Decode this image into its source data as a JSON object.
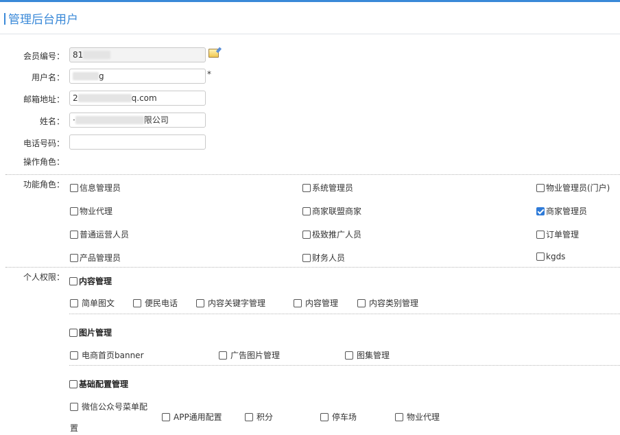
{
  "page": {
    "title": "管理后台用户",
    "accent": "#3a89d8"
  },
  "form": {
    "member_no": {
      "label": "会员编号：",
      "value": "81"
    },
    "username": {
      "label": "用户名：",
      "value_suffix": "g",
      "required_mark": "*"
    },
    "email": {
      "label": "邮箱地址：",
      "value_prefix": "2",
      "value_suffix": "q.com"
    },
    "name": {
      "label": "姓名：",
      "value_prefix": "·",
      "value_suffix": "限公司"
    },
    "phone": {
      "label": "电话号码：",
      "value": ""
    },
    "op_role": {
      "label": "操作角色："
    }
  },
  "function_roles": {
    "label": "功能角色：",
    "items": [
      {
        "label": "信息管理员",
        "checked": false
      },
      {
        "label": "系统管理员",
        "checked": false
      },
      {
        "label": "物业管理员(门户)",
        "checked": false
      },
      {
        "label": "物业代理",
        "checked": false
      },
      {
        "label": "商家联盟商家",
        "checked": false
      },
      {
        "label": "商家管理员",
        "checked": true
      },
      {
        "label": "普通运营人员",
        "checked": false
      },
      {
        "label": "极致推广人员",
        "checked": false
      },
      {
        "label": "订单管理",
        "checked": false
      },
      {
        "label": "产品管理员",
        "checked": false
      },
      {
        "label": "财务人员",
        "checked": false
      },
      {
        "label": "kgds",
        "checked": false
      }
    ]
  },
  "personal_perms": {
    "label": "个人权限：",
    "groups": [
      {
        "title": "内容管理",
        "items": [
          "简单图文",
          "便民电话",
          "内容关键字管理",
          "内容管理",
          "内容类别管理"
        ]
      },
      {
        "title": "图片管理",
        "items": [
          "电商首页banner",
          "广告图片管理",
          "图集管理"
        ]
      },
      {
        "title": "基础配置管理",
        "items": [
          "微信公众号菜单配",
          "置",
          "APP通用配置",
          "积分",
          "停车场",
          "物业代理"
        ]
      }
    ]
  }
}
